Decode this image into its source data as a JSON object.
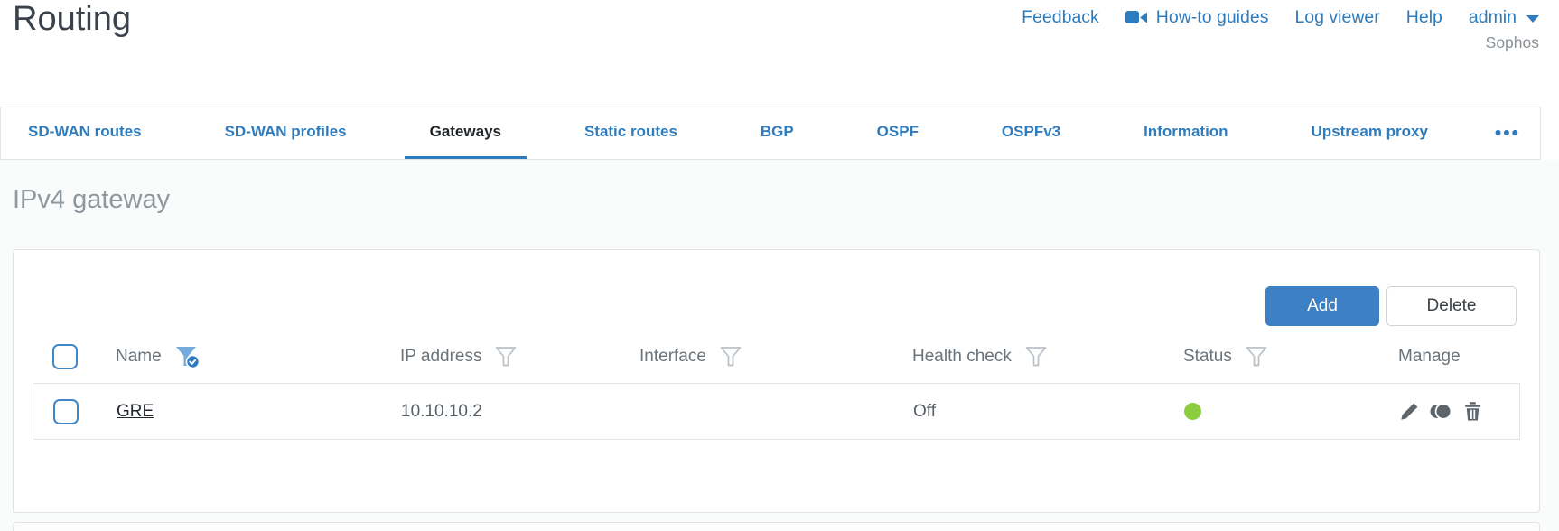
{
  "page": {
    "title": "Routing"
  },
  "header": {
    "links": {
      "feedback": "Feedback",
      "howto": "How-to guides",
      "log_viewer": "Log viewer",
      "help": "Help",
      "user": "admin"
    },
    "brand": "Sophos"
  },
  "tabs": {
    "items": [
      {
        "label": "SD-WAN routes",
        "active": false
      },
      {
        "label": "SD-WAN profiles",
        "active": false
      },
      {
        "label": "Gateways",
        "active": true
      },
      {
        "label": "Static routes",
        "active": false
      },
      {
        "label": "BGP",
        "active": false
      },
      {
        "label": "OSPF",
        "active": false
      },
      {
        "label": "OSPFv3",
        "active": false
      },
      {
        "label": "Information",
        "active": false
      },
      {
        "label": "Upstream proxy",
        "active": false
      }
    ],
    "overflow": "•••"
  },
  "section": {
    "heading": "IPv4 gateway"
  },
  "toolbar": {
    "add_label": "Add",
    "delete_label": "Delete"
  },
  "table": {
    "columns": [
      {
        "label": "Name",
        "filter": "active"
      },
      {
        "label": "IP address",
        "filter": "inactive"
      },
      {
        "label": "Interface",
        "filter": "inactive"
      },
      {
        "label": "Health check",
        "filter": "inactive"
      },
      {
        "label": "Status",
        "filter": "inactive"
      },
      {
        "label": "Manage",
        "filter": "none"
      }
    ],
    "rows": [
      {
        "name": "GRE",
        "ip_address": "10.10.10.2",
        "interface": "",
        "health_check": "Off",
        "status": "green",
        "actions": [
          "edit",
          "clone",
          "delete"
        ]
      }
    ]
  },
  "colors": {
    "accent_blue": "#2e7cbe",
    "button_blue": "#3d80c4",
    "status_green": "#8ccd3f"
  }
}
